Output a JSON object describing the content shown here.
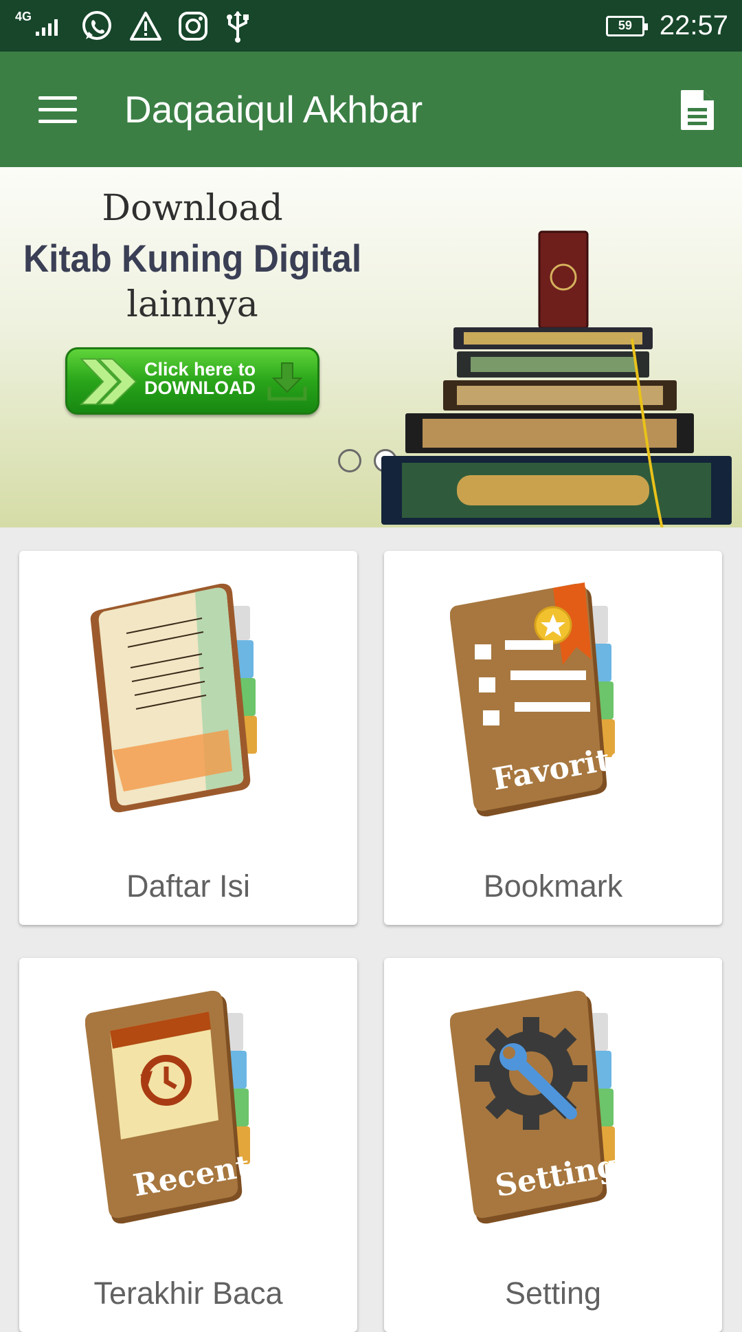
{
  "status_bar": {
    "network": "4G",
    "battery": "59",
    "time": "22:57",
    "icons": [
      "signal-icon",
      "whatsapp-icon",
      "warning-icon",
      "instagram-icon",
      "usb-icon",
      "battery-icon"
    ]
  },
  "app_bar": {
    "title": "Daqaaiqul Akhbar",
    "icons": [
      "hamburger-menu-icon",
      "document-icon"
    ],
    "color": "#3b7f45"
  },
  "banner": {
    "line1": "Download",
    "line2": "Kitab Kuning Digital",
    "line3": "lainnya",
    "button_line1": "Click here to",
    "button_line2": "DOWNLOAD",
    "page_count": 2,
    "active_page": 2
  },
  "menu": [
    {
      "label": "Daftar Isi",
      "book_text": ""
    },
    {
      "label": "Bookmark",
      "book_text": "Favorite"
    },
    {
      "label": "Terakhir Baca",
      "book_text": "Recent"
    },
    {
      "label": "Setting",
      "book_text": "Setting"
    }
  ],
  "colors": {
    "status_bar": "#17462a",
    "app_bar": "#3b7f45",
    "book_cover": "#a7773f",
    "caption": "#616161"
  }
}
